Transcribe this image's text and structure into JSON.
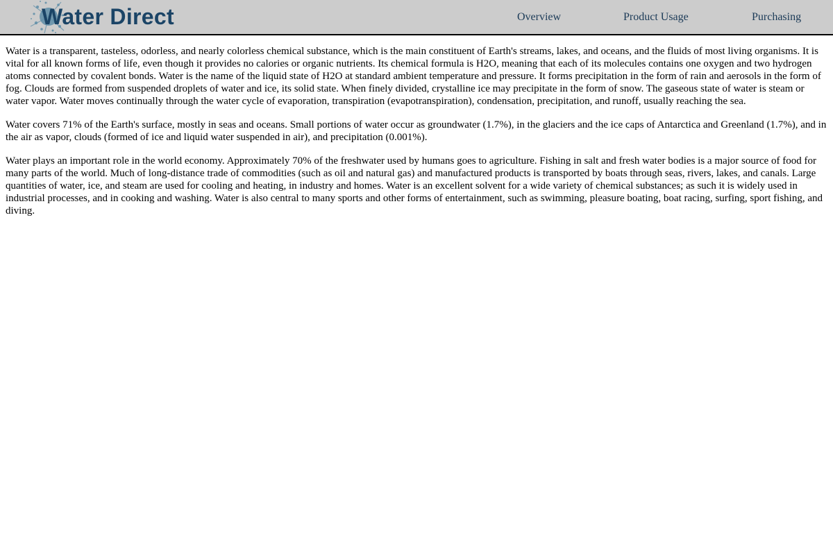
{
  "header": {
    "logo_text": "Water Direct",
    "nav": {
      "overview": "Overview",
      "product_usage": "Product Usage",
      "purchasing": "Purchasing"
    }
  },
  "content": {
    "paragraphs": [
      "Water is a transparent, tasteless, odorless, and nearly colorless chemical substance, which is the main constituent of Earth's streams, lakes, and oceans, and the fluids of most living organisms. It is vital for all known forms of life, even though it provides no calories or organic nutrients. Its chemical formula is H2O, meaning that each of its molecules contains one oxygen and two hydrogen atoms connected by covalent bonds. Water is the name of the liquid state of H2O at standard ambient temperature and pressure. It forms precipitation in the form of rain and aerosols in the form of fog. Clouds are formed from suspended droplets of water and ice, its solid state. When finely divided, crystalline ice may precipitate in the form of snow. The gaseous state of water is steam or water vapor. Water moves continually through the water cycle of evaporation, transpiration (evapotranspiration), condensation, precipitation, and runoff, usually reaching the sea.",
      "Water covers 71% of the Earth's surface, mostly in seas and oceans. Small portions of water occur as groundwater (1.7%), in the glaciers and the ice caps of Antarctica and Greenland (1.7%), and in the air as vapor, clouds (formed of ice and liquid water suspended in air), and precipitation (0.001%).",
      "Water plays an important role in the world economy. Approximately 70% of the freshwater used by humans goes to agriculture. Fishing in salt and fresh water bodies is a major source of food for many parts of the world. Much of long-distance trade of commodities (such as oil and natural gas) and manufactured products is transported by boats through seas, rivers, lakes, and canals. Large quantities of water, ice, and steam are used for cooling and heating, in industry and homes. Water is an excellent solvent for a wide variety of chemical substances; as such it is widely used in industrial processes, and in cooking and washing. Water is also central to many sports and other forms of entertainment, such as swimming, pleasure boating, boat racing, surfing, sport fishing, and diving."
    ]
  },
  "colors": {
    "header_bg": "#cccccc",
    "logo_text": "#1b4466",
    "nav_link": "#1b3a57",
    "splash": "#5f8ea8"
  }
}
